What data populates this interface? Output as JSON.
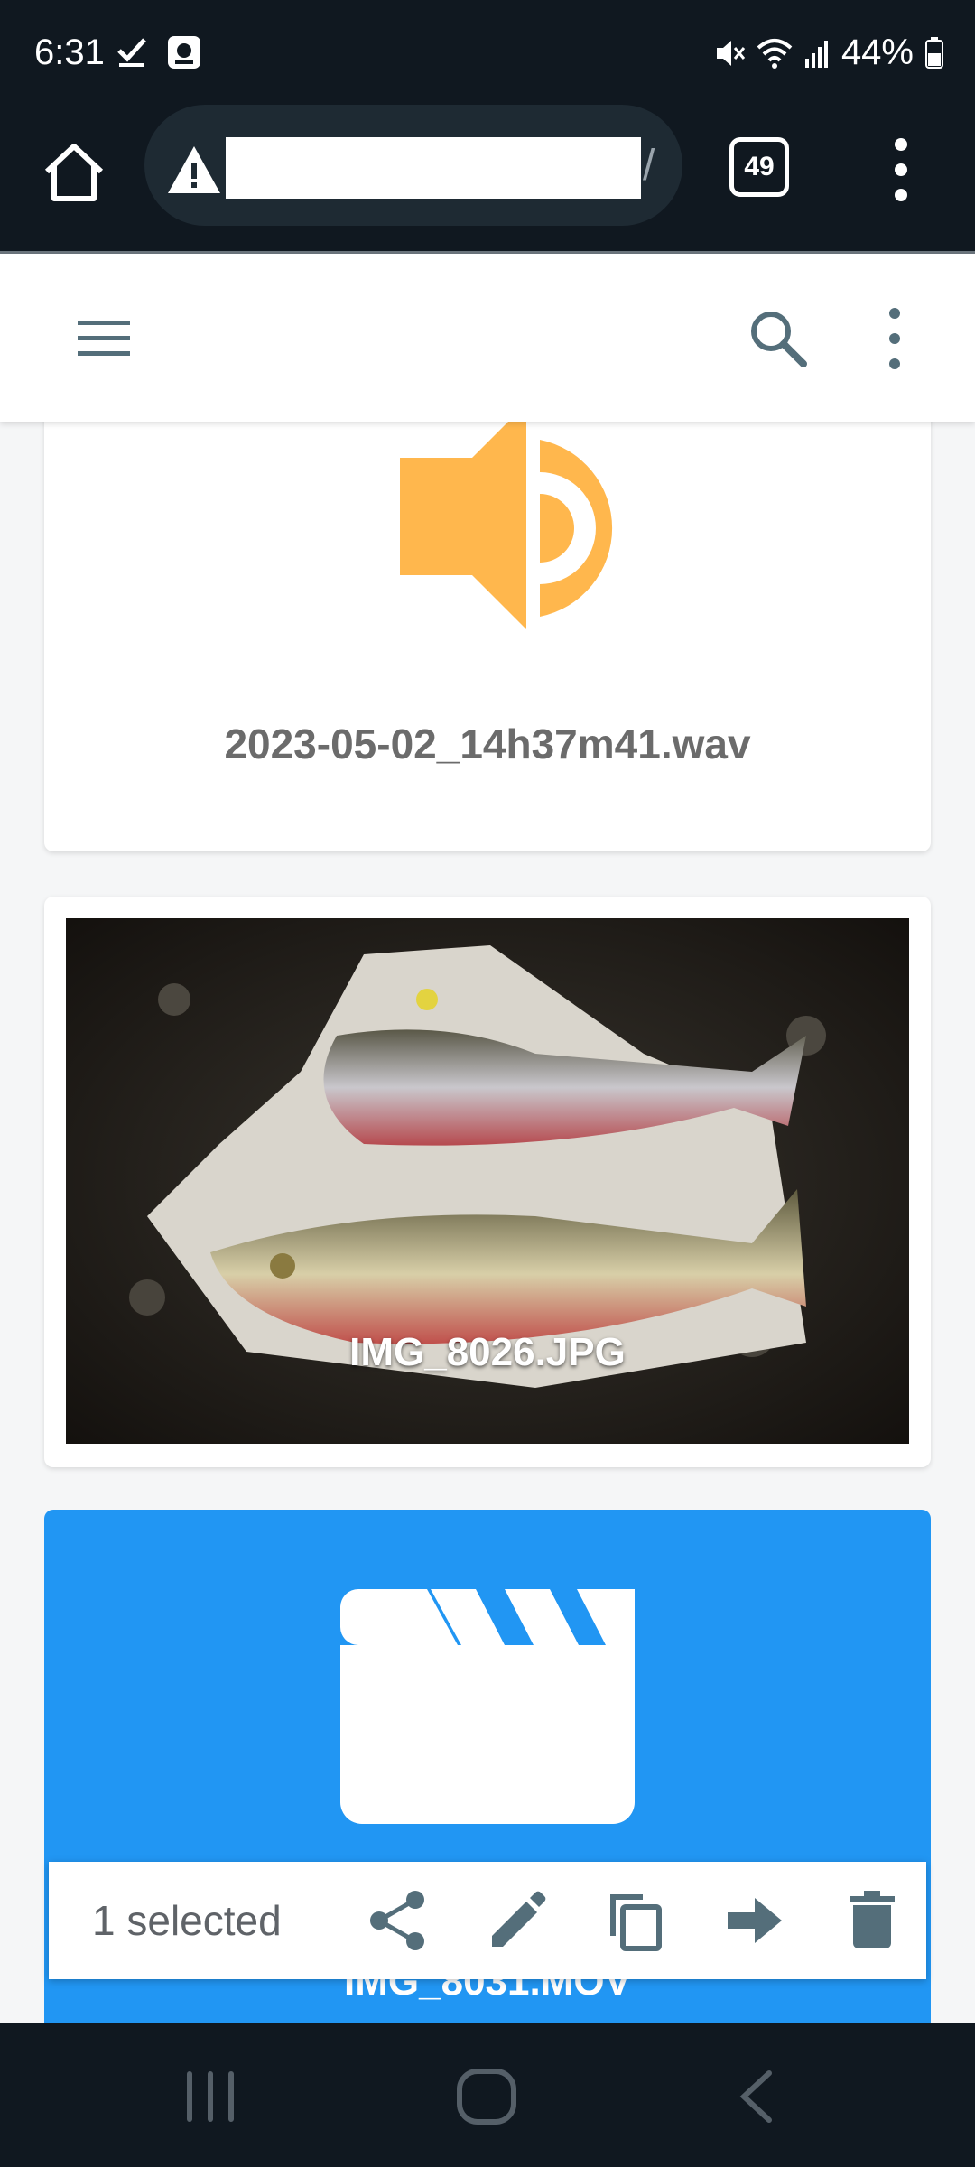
{
  "status": {
    "time": "6:31",
    "battery": "44%",
    "left_icons": [
      "checkmark-icon",
      "camera-notification-icon"
    ],
    "right_icons": [
      "mute-icon",
      "wifi-icon",
      "signal-icon",
      "battery-icon"
    ]
  },
  "browser": {
    "url": "",
    "tab_count": "49"
  },
  "files": [
    {
      "name": "2023-05-02_14h37m41.wav",
      "type": "audio",
      "icon": "speaker-icon"
    },
    {
      "name": "IMG_8026.JPG",
      "type": "image"
    },
    {
      "name": "IMG_8031.MOV",
      "type": "video",
      "icon": "clapperboard-icon",
      "selected": true
    }
  ],
  "selection": {
    "label": "1 selected",
    "actions": [
      "share",
      "rename",
      "copy",
      "move",
      "delete"
    ]
  },
  "colors": {
    "accent": "#2196f3",
    "audio_icon": "#ffb74d",
    "dark_bar": "#101820"
  }
}
